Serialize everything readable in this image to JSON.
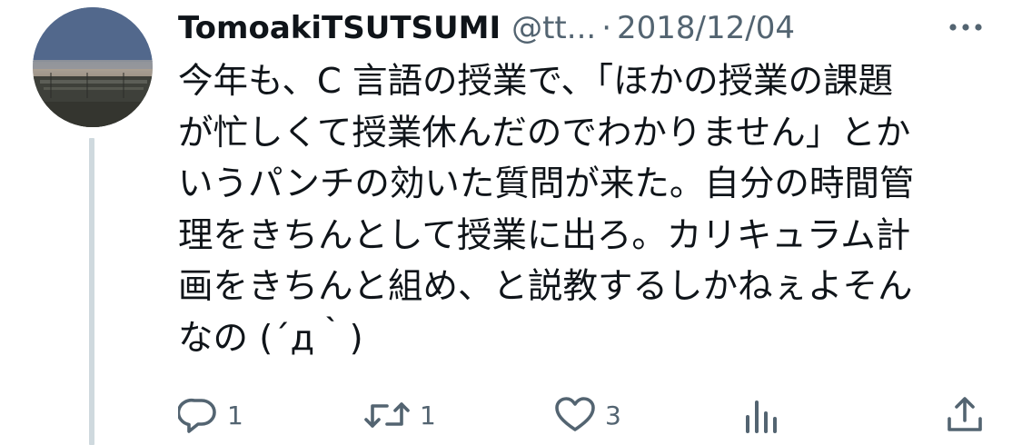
{
  "tweet": {
    "display_name": "TomoakiTSUTSUMI",
    "handle": "@tt...",
    "separator": "·",
    "date": "2018/12/04",
    "text_lines": [
      "今年も、C 言語の授業で、「ほかの授業の課題",
      "が忙しくて授業休んだのでわかりません」とか",
      "いうパンチの効いた質問が来た。自分の時間管",
      "理をきちんとして授業に出ろ。カリキュラム計",
      "画をきちんと組め、と説教するしかねぇよそん",
      "なの (´д｀)"
    ]
  },
  "actions": {
    "reply": {
      "icon": "reply-icon",
      "count": "1"
    },
    "retweet": {
      "icon": "retweet-icon",
      "count": "1"
    },
    "like": {
      "icon": "heart-icon",
      "count": "3"
    },
    "analytics": {
      "icon": "analytics-icon"
    },
    "share": {
      "icon": "share-icon"
    }
  },
  "colors": {
    "text": "#0f1419",
    "secondary": "#536471",
    "thread_line": "#cfd9de",
    "background": "#ffffff"
  }
}
